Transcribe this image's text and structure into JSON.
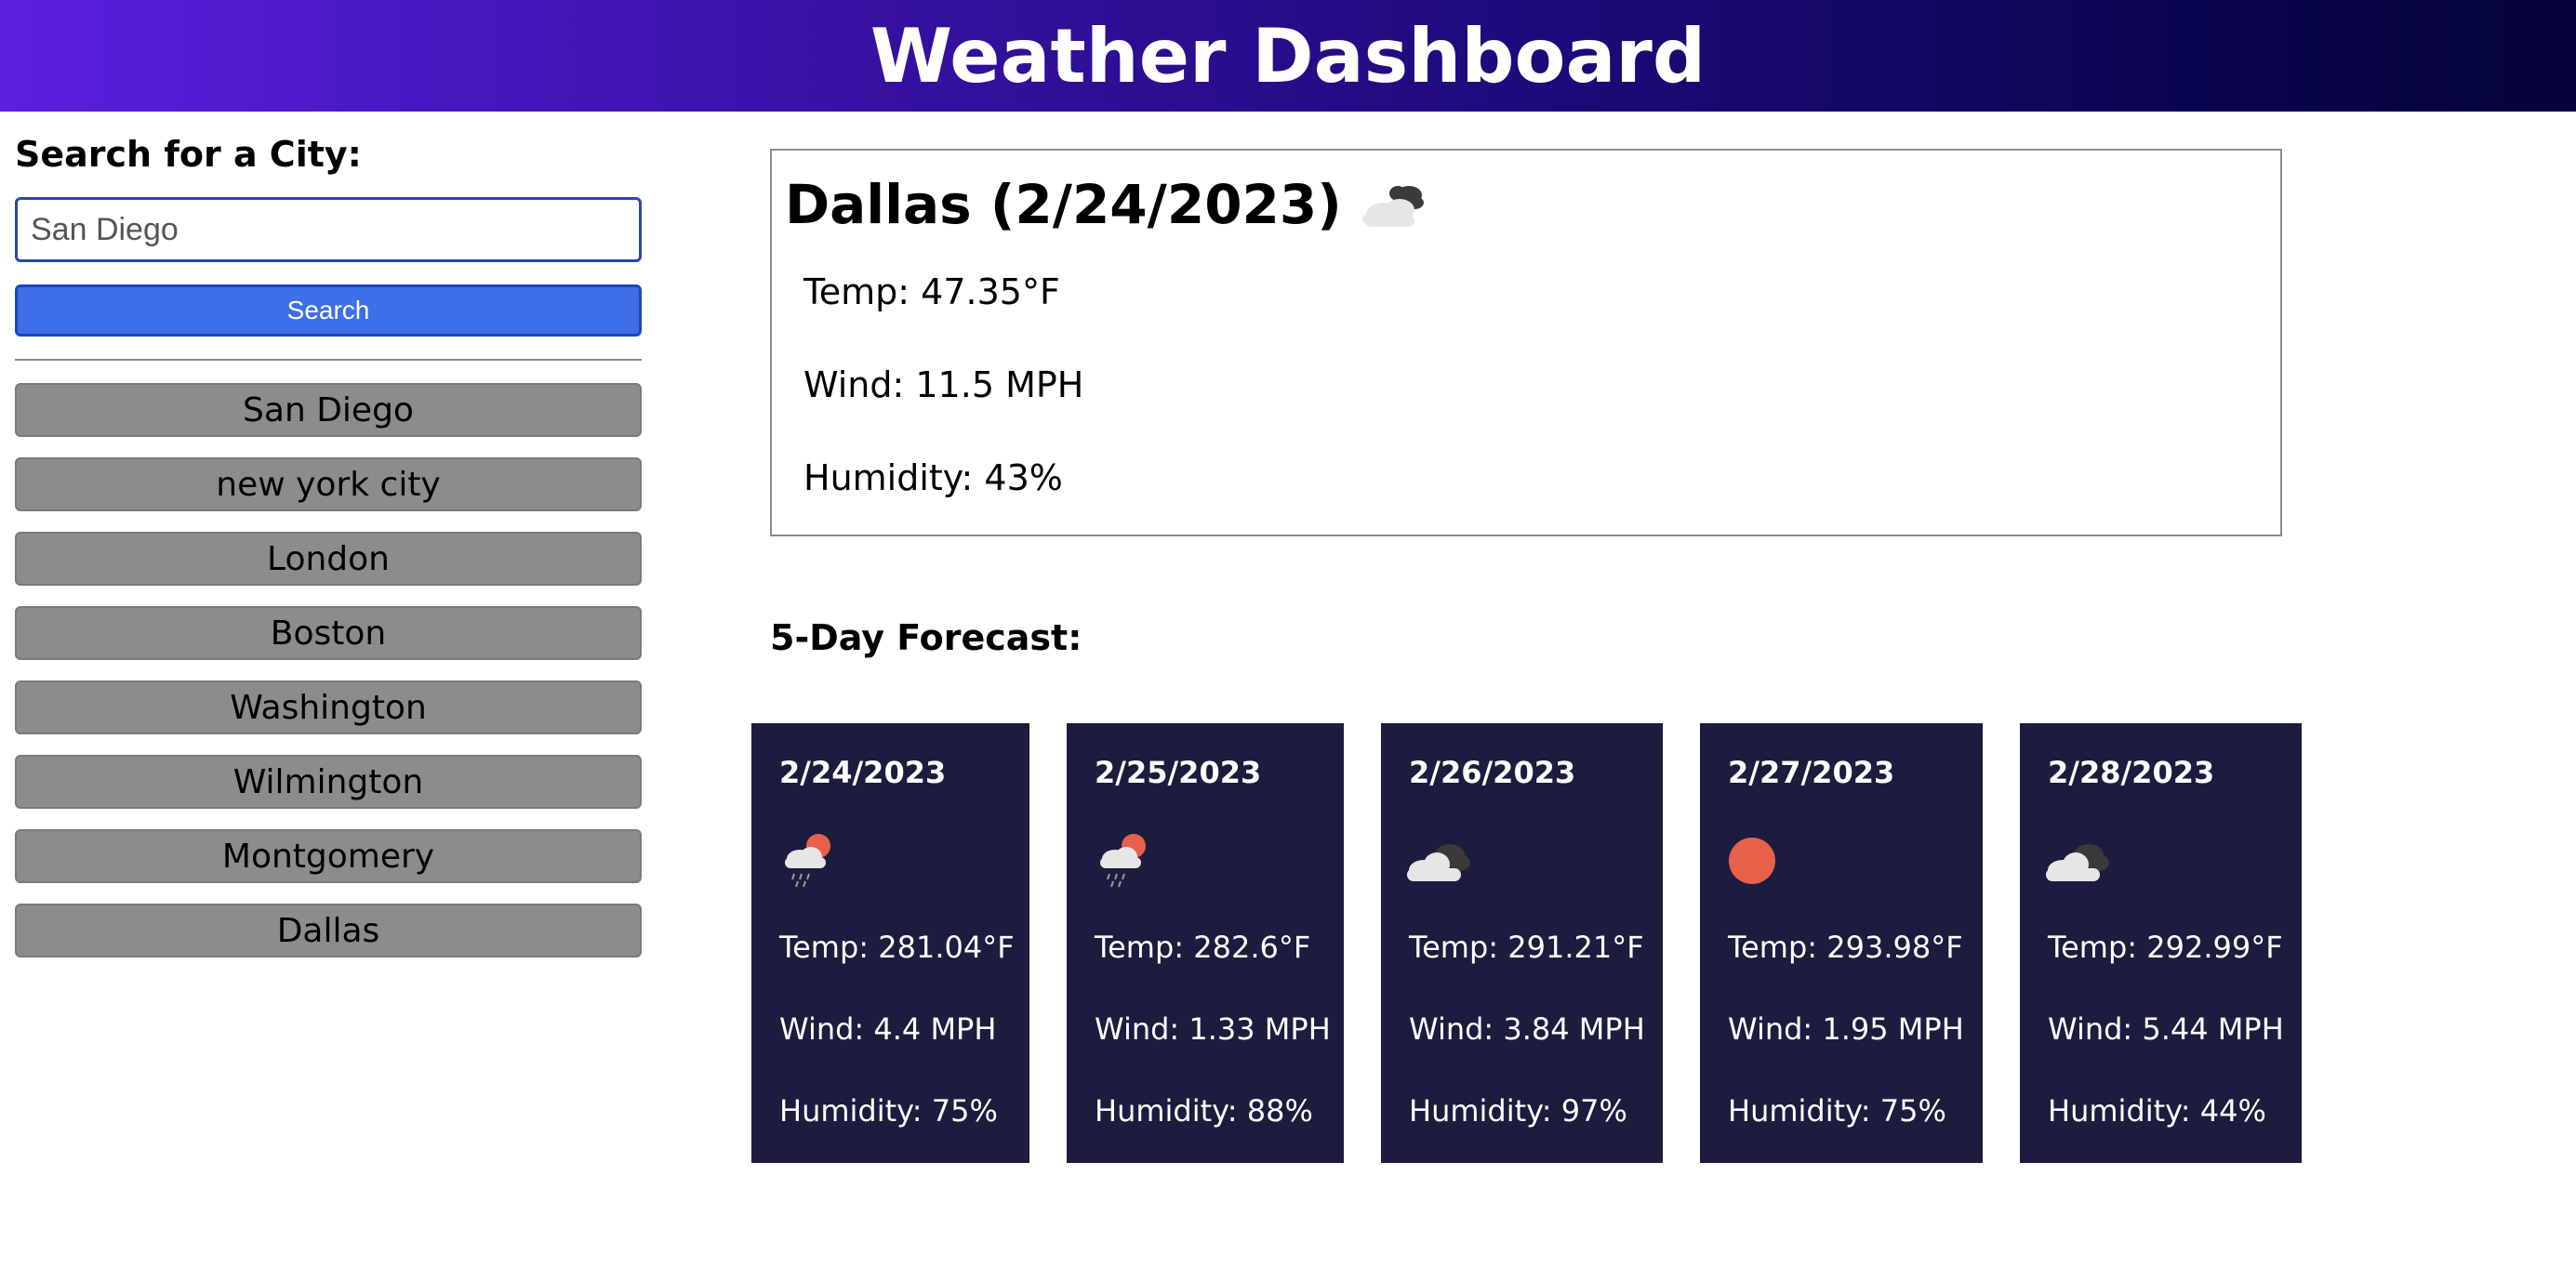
{
  "header": {
    "title": "Weather Dashboard"
  },
  "sidebar": {
    "search_label": "Search for a City:",
    "search_value": "San Diego",
    "search_button": "Search",
    "history": [
      "San Diego",
      "new york city",
      "London",
      "Boston",
      "Washington",
      "Wilmington",
      "Montgomery",
      "Dallas"
    ]
  },
  "current": {
    "title": "Dallas (2/24/2023)",
    "icon": "clouds-icon",
    "temp": "Temp: 47.35°F",
    "wind": "Wind: 11.5 MPH",
    "humidity": "Humidity: 43%"
  },
  "forecast": {
    "heading": "5-Day Forecast:",
    "days": [
      {
        "date": "2/24/2023",
        "icon": "rain-sun-icon",
        "temp": "Temp: 281.04°F",
        "wind": "Wind: 4.4 MPH",
        "humidity": "Humidity: 75%"
      },
      {
        "date": "2/25/2023",
        "icon": "rain-sun-icon",
        "temp": "Temp: 282.6°F",
        "wind": "Wind: 1.33 MPH",
        "humidity": "Humidity: 88%"
      },
      {
        "date": "2/26/2023",
        "icon": "broken-clouds-icon",
        "temp": "Temp: 291.21°F",
        "wind": "Wind: 3.84 MPH",
        "humidity": "Humidity: 97%"
      },
      {
        "date": "2/27/2023",
        "icon": "sun-icon",
        "temp": "Temp: 293.98°F",
        "wind": "Wind: 1.95 MPH",
        "humidity": "Humidity: 75%"
      },
      {
        "date": "2/28/2023",
        "icon": "broken-clouds-icon",
        "temp": "Temp: 292.99°F",
        "wind": "Wind: 5.44 MPH",
        "humidity": "Humidity: 44%"
      }
    ]
  },
  "colors": {
    "header_start": "#5b1fe0",
    "header_end": "#050338",
    "search_button": "#3e6ee8",
    "history_button": "#8c8c8c",
    "card_bg": "#1b1c3e",
    "sun": "#e8604a"
  }
}
